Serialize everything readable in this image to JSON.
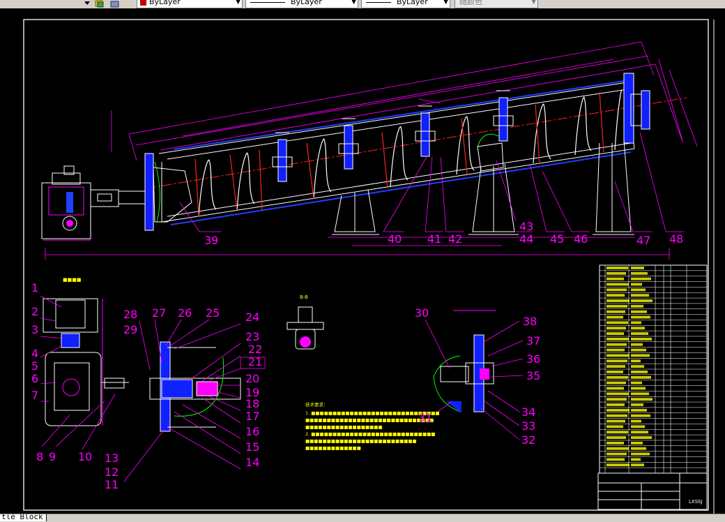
{
  "toolbar": {
    "color_combo": "ByLayer",
    "linetype_combo": "ByLayer",
    "lineweight_combo": "ByLayer",
    "plotstyle_combo": "随颜色"
  },
  "callouts_main": [
    "39",
    "40",
    "41",
    "42",
    "43",
    "44",
    "45",
    "46",
    "47",
    "48"
  ],
  "callouts_bottom_left": [
    "1",
    "2",
    "3",
    "4",
    "5",
    "6",
    "7",
    "8",
    "9",
    "10",
    "11",
    "12",
    "13",
    "14",
    "15",
    "16",
    "17",
    "18",
    "19",
    "20",
    "21",
    "22",
    "23",
    "24",
    "25",
    "26",
    "27",
    "28",
    "29"
  ],
  "callouts_right_detail": [
    "30",
    "31",
    "32",
    "33",
    "34",
    "35",
    "36",
    "37",
    "38"
  ],
  "section_label": "B-B",
  "title_block_code": "LXSSJ",
  "layout_tab": "tle Block"
}
